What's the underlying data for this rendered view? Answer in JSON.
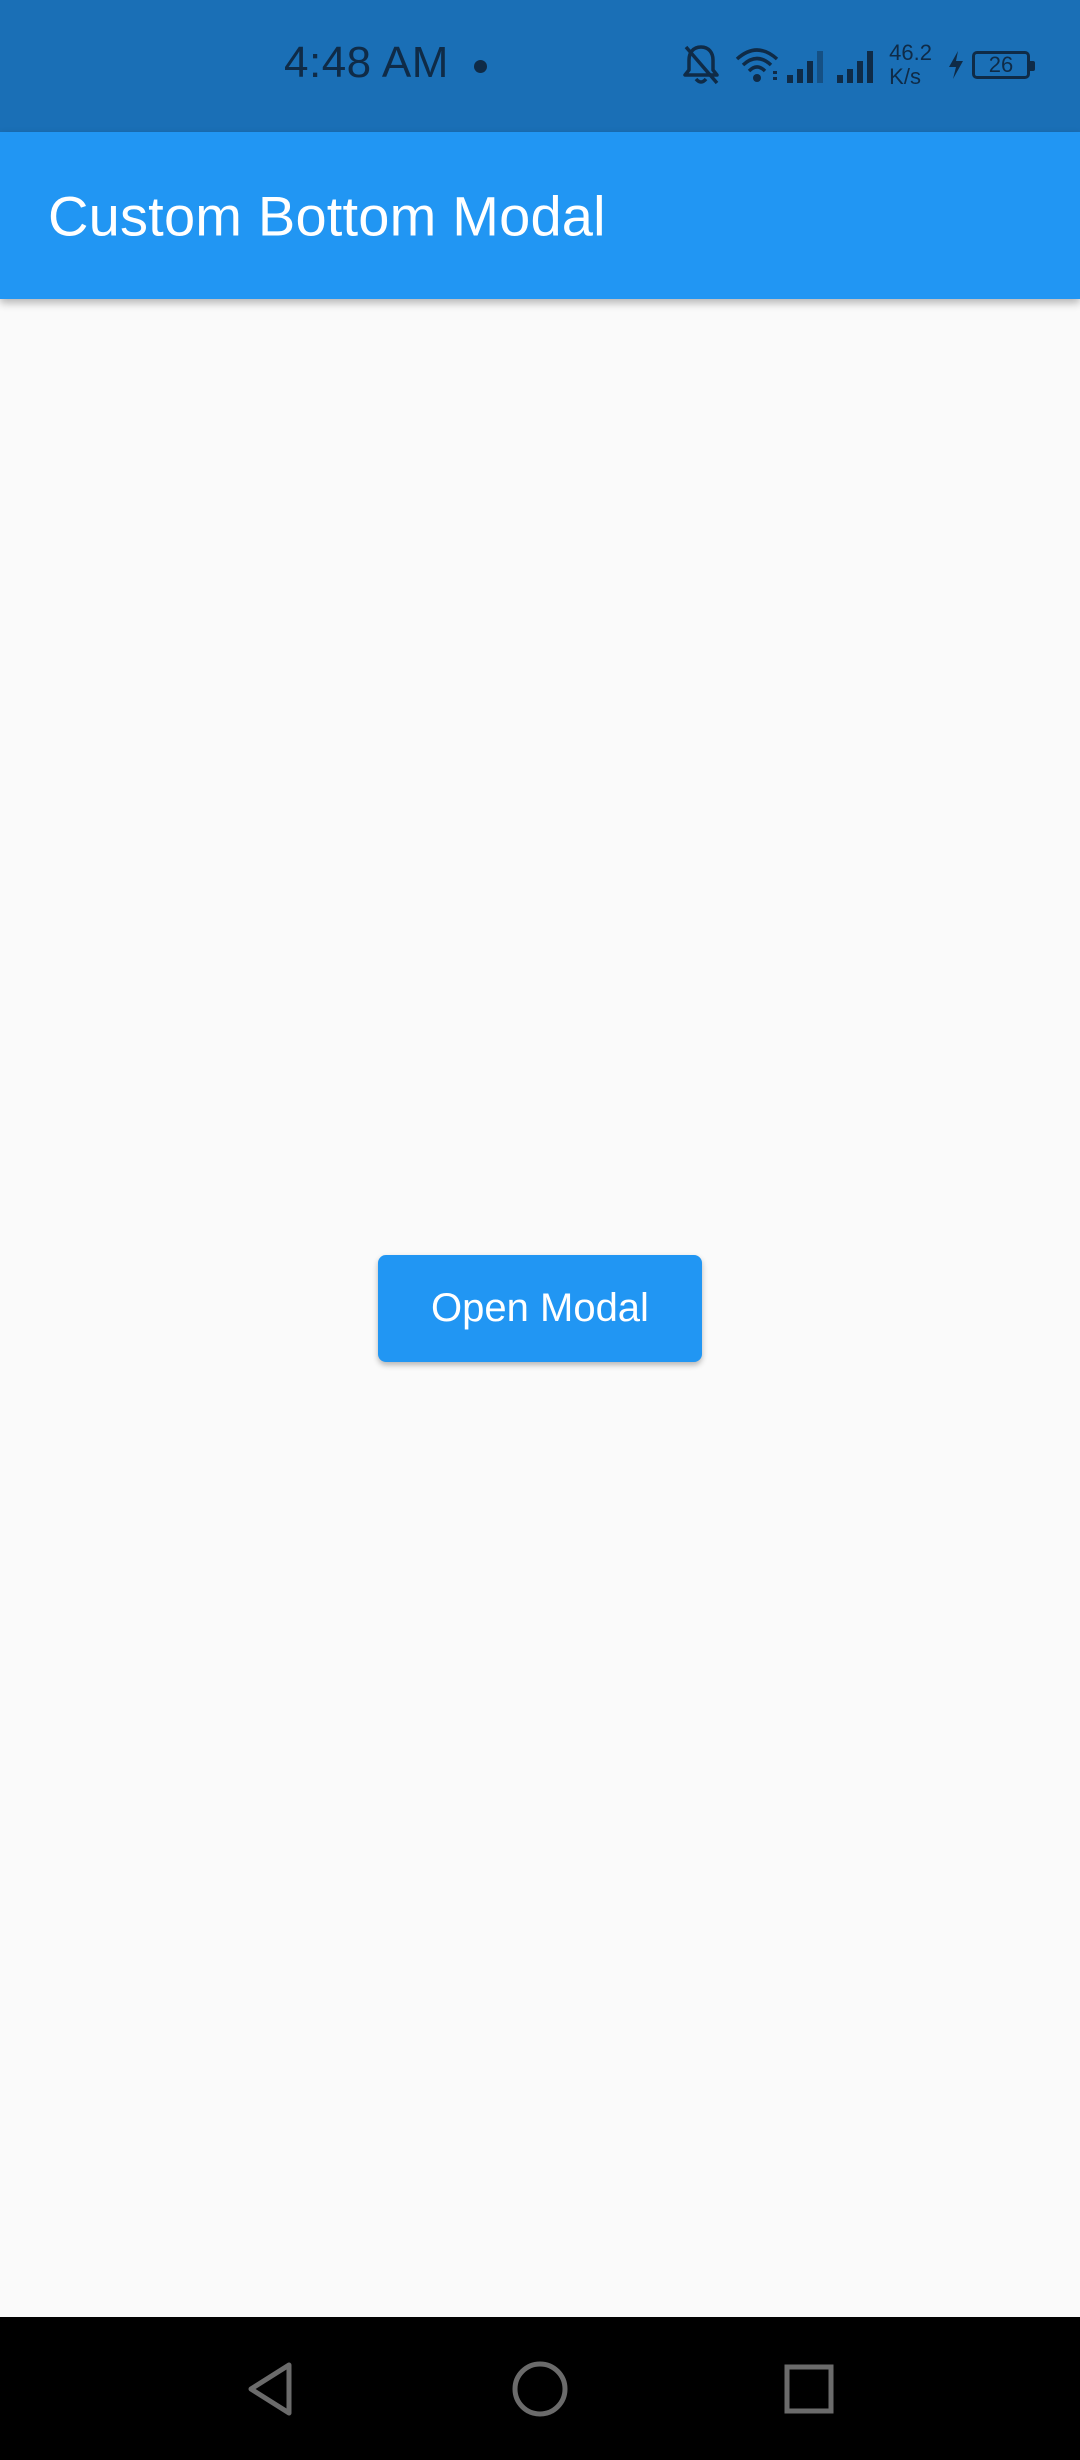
{
  "status_bar": {
    "time": "4:48 AM",
    "net_speed_value": "46.2",
    "net_speed_unit": "K/s",
    "battery_level": "26",
    "icons": [
      "notifications-off-icon",
      "wifi-icon",
      "signal-icon",
      "signal-icon",
      "charging-icon",
      "battery-icon"
    ]
  },
  "app_bar": {
    "title": "Custom Bottom Modal"
  },
  "main": {
    "open_modal_label": "Open Modal"
  },
  "nav_bar": {
    "icons": [
      "back-icon",
      "home-icon",
      "recents-icon"
    ]
  },
  "colors": {
    "status_bar": "#1a6fb6",
    "primary": "#2196f3",
    "background": "#fafafa",
    "nav_bar": "#000000"
  }
}
